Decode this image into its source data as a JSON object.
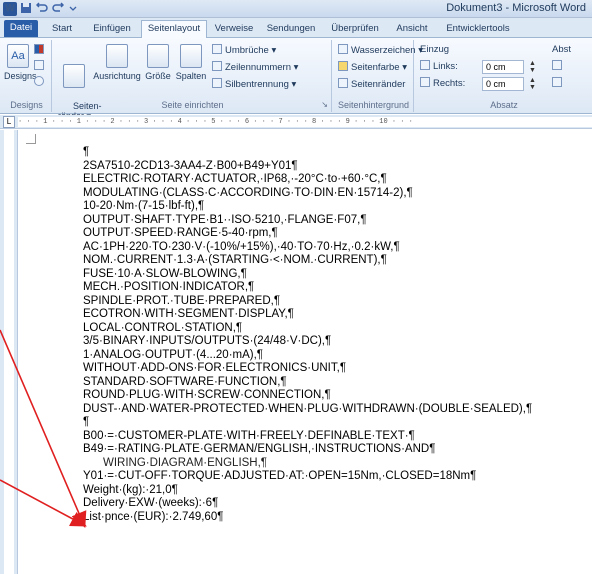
{
  "titlebar": {
    "app_title": "Dokument3 - Microsoft Word",
    "word_icon": "W"
  },
  "tabs": [
    "Datei",
    "Start",
    "Einfügen",
    "Seitenlayout",
    "Verweise",
    "Sendungen",
    "Überprüfen",
    "Ansicht",
    "Entwicklertools"
  ],
  "ribbon": {
    "designs": {
      "button": "Designs",
      "group": "Designs"
    },
    "page_setup": {
      "margins": "Seiten-\nränder ▾",
      "orientation": "Ausrichtung",
      "size": "Größe",
      "columns": "Spalten",
      "breaks": "Umbrüche ▾",
      "line_numbers": "Zeilennummern ▾",
      "hyphenation": "Silbentrennung ▾",
      "group": "Seite einrichten"
    },
    "page_background": {
      "watermark": "Wasserzeichen ▾",
      "page_color": "Seitenfarbe ▾",
      "page_borders": "Seitenränder",
      "group": "Seitenhintergrund"
    },
    "paragraph": {
      "indent_label": "Einzug",
      "left_label": "Links:",
      "left_value": "0 cm",
      "right_label": "Rechts:",
      "right_value": "0 cm",
      "spacing_label": "Abst",
      "group": "Absatz"
    }
  },
  "ruler": {
    "marks": "· · · 1 · · · 1 · · · 2 · · · 3 · · · 4 · · · 5 · · · 6 · · · 7 · · · 8 · · · 9 · · · 10 · · ·"
  },
  "document": {
    "lines": [
      "¶",
      "2SA7510-2CD13-3AA4-Z·B00+B49+Y01¶",
      "ELECTRIC·ROTARY·ACTUATOR,·IP68,·-20°C·to·+60·°C,¶",
      "MODULATING·(CLASS·C·ACCORDING·TO·DIN·EN·15714-2),¶",
      "10-20·Nm·(7-15·lbf-ft),¶",
      "OUTPUT·SHAFT·TYPE·B1··ISO·5210,·FLANGE·F07,¶",
      "OUTPUT·SPEED·RANGE·5-40·rpm,¶",
      "AC·1PH·220·TO·230·V·(-10%/+15%),·40·TO·70·Hz,·0.2·kW,¶",
      "NOM.·CURRENT·1.3·A·(STARTING·<·NOM.·CURRENT),¶",
      "FUSE·10·A·SLOW-BLOWING,¶",
      "MECH.·POSITION·INDICATOR,¶",
      "SPINDLE·PROT.·TUBE·PREPARED,¶",
      "ECOTRON·WITH·SEGMENT·DISPLAY,¶",
      "LOCAL·CONTROL·STATION,¶",
      "3/5·BINARY·INPUTS/OUTPUTS·(24/48·V·DC),¶",
      "1·ANALOG·OUTPUT·(4...20·mA),¶",
      "WITHOUT·ADD-ONS·FOR·ELECTRONICS·UNIT,¶",
      "STANDARD·SOFTWARE·FUNCTION,¶",
      "ROUND·PLUG·WITH·SCREW·CONNECTION,¶",
      "DUST-·AND·WATER-PROTECTED·WHEN·PLUG·WITHDRAWN·(DOUBLE·SEALED),¶",
      "¶",
      "B00·=·CUSTOMER-PLATE·WITH·FREELY·DEFINABLE·TEXT·¶",
      "B49·=·RATING·PLATE·GERMAN/ENGLISH,·INSTRUCTIONS·AND¶",
      "WIRING·DIAGRAM·ENGLISH,¶",
      "Y01·=·CUT-OFF·TORQUE·ADJUSTED·AT:·OPEN=15Nm,·CLOSED=18Nm¶",
      "Weight·(kg):·21,0¶",
      "Delivery·EXW·(weeks):·6¶",
      "List·pnce·(EUR):·2.749,60¶"
    ]
  },
  "colors": {
    "arrow": "#e02020",
    "ribbon_bg": "#dde8f5",
    "file_tab": "#2a5da8"
  }
}
